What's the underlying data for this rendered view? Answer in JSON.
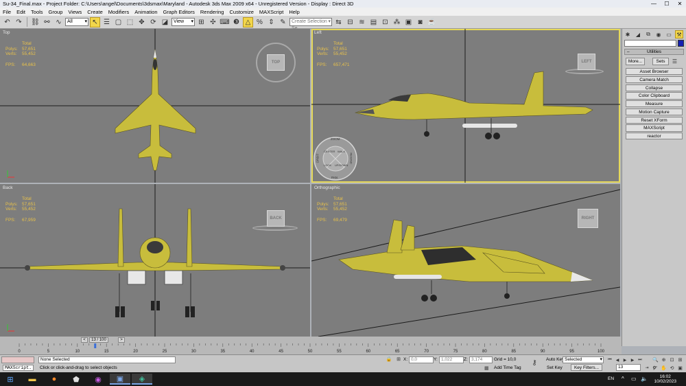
{
  "window": {
    "title": "Su-34_Final.max    - Project Folder: C:\\Users\\angel\\Documents\\3dsmax\\Maryland      - Autodesk 3ds Max  2009 x64    - Unregistered Version       - Display : Direct 3D",
    "min": "—",
    "max": "☐",
    "close": "✕"
  },
  "menu": [
    "File",
    "Edit",
    "Tools",
    "Group",
    "Views",
    "Create",
    "Modifiers",
    "Animation",
    "Graph Editors",
    "Rendering",
    "Customize",
    "MAXScript",
    "Help"
  ],
  "toolbar": {
    "filter": "All",
    "refcoord": "View",
    "selset_placeholder": "Create Selection Se"
  },
  "viewports": [
    {
      "id": "top",
      "label": "Top",
      "total": "Total",
      "polys_k": "Polys:",
      "polys": "57,651",
      "verts_k": "Verts:",
      "verts": "55,452",
      "fps_k": "FPS:",
      "fps": "64,663",
      "cube": "TOP"
    },
    {
      "id": "left",
      "label": "Left",
      "total": "Total",
      "polys_k": "Polys:",
      "polys": "57,651",
      "verts_k": "Verts:",
      "verts": "55,452",
      "fps_k": "FPS:",
      "fps": "657,471",
      "cube": "LEFT"
    },
    {
      "id": "back",
      "label": "Back",
      "total": "Total",
      "polys_k": "Polys:",
      "polys": "57,651",
      "verts_k": "Verts:",
      "verts": "55,452",
      "fps_k": "FPS:",
      "fps": "67,959",
      "cube": "BACK"
    },
    {
      "id": "ortho",
      "label": "Orthographic",
      "total": "Total",
      "polys_k": "Polys:",
      "polys": "57,651",
      "verts_k": "Verts:",
      "verts": "55,452",
      "fps_k": "FPS:",
      "fps": "69,479",
      "cube": "RIGHT"
    }
  ],
  "wheel": {
    "zoom": "ZOOM",
    "orbit": "ORBIT",
    "pan": "PAN",
    "center": "CENTER",
    "walk": "WALK",
    "rewind": "REWIND",
    "look": "LOOK",
    "updown": "UP/DOWN"
  },
  "utilities": {
    "title": "Utilities",
    "more": "More...",
    "sets": "Sets",
    "items": [
      "Asset Browser",
      "Camera Match",
      "Collapse",
      "Color Clipboard",
      "Measure",
      "Motion Capture",
      "Reset XForm",
      "MAXScript",
      "reactor"
    ]
  },
  "timeline": {
    "position": "13 / 100",
    "prev": "<",
    "next": ">",
    "frame_fraction": 0.13,
    "ticks": [
      "0",
      "5",
      "10",
      "15",
      "20",
      "25",
      "30",
      "35",
      "40",
      "45",
      "50",
      "55",
      "60",
      "65",
      "70",
      "75",
      "80",
      "85",
      "90",
      "95",
      "100"
    ]
  },
  "status": {
    "maxscript": "MAXScript.",
    "selection": "None Selected",
    "prompt": "Click or click-and-drag to select objects",
    "x_label": "X:",
    "x": "0,0",
    "y_label": "Y:",
    "y": "1,022",
    "z_label": "Z:",
    "z": "3,174",
    "grid": "Grid = 10,0",
    "add_time_tag": "Add Time Tag",
    "auto_key": "Auto Key",
    "set_key": "Set Key",
    "selected": "Selected",
    "key_filters": "Key Filters...",
    "frame": "13"
  },
  "taskbar": {
    "lang": "EN",
    "time": "16:02",
    "date": "10/02/2023"
  },
  "colors": {
    "accent": "#e6d95a",
    "viewport": "#7d7d7d",
    "stats": "#e9c24a",
    "jet": "#c8bd3c"
  }
}
